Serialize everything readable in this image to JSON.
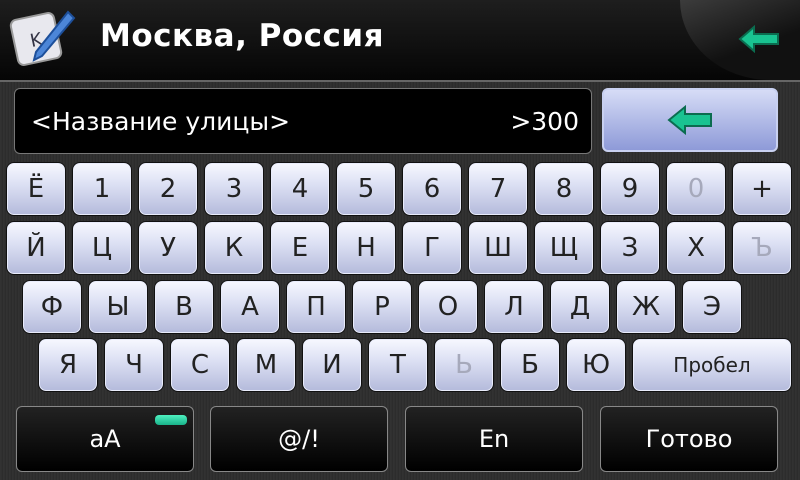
{
  "header": {
    "title": "Москва, Россия",
    "back_icon": "green-back-arrow-icon",
    "app_icon": "keyboard-pen-icon"
  },
  "input": {
    "value": "<Название улицы>",
    "count": ">300"
  },
  "backspace_icon": "green-back-arrow-icon",
  "keyboard": {
    "row1": [
      "Ё",
      "1",
      "2",
      "3",
      "4",
      "5",
      "6",
      "7",
      "8",
      "9",
      "0",
      "+"
    ],
    "row2": [
      "Й",
      "Ц",
      "У",
      "К",
      "Е",
      "Н",
      "Г",
      "Ш",
      "Щ",
      "З",
      "Х",
      "Ъ"
    ],
    "row3": [
      "Ф",
      "Ы",
      "В",
      "А",
      "П",
      "Р",
      "О",
      "Л",
      "Д",
      "Ж",
      "Э"
    ],
    "row4": [
      "Я",
      "Ч",
      "С",
      "М",
      "И",
      "Т",
      "Ь",
      "Б",
      "Ю"
    ],
    "space_label": "Пробел",
    "disabled_keys": [
      "0",
      "Ъ",
      "Ь"
    ]
  },
  "bottom": {
    "case_label": "aA",
    "symbols_label": "@/!",
    "lang_label": "En",
    "done_label": "Готово"
  },
  "colors": {
    "accent_green": "#19c391",
    "key_blue": "#b4badb"
  }
}
